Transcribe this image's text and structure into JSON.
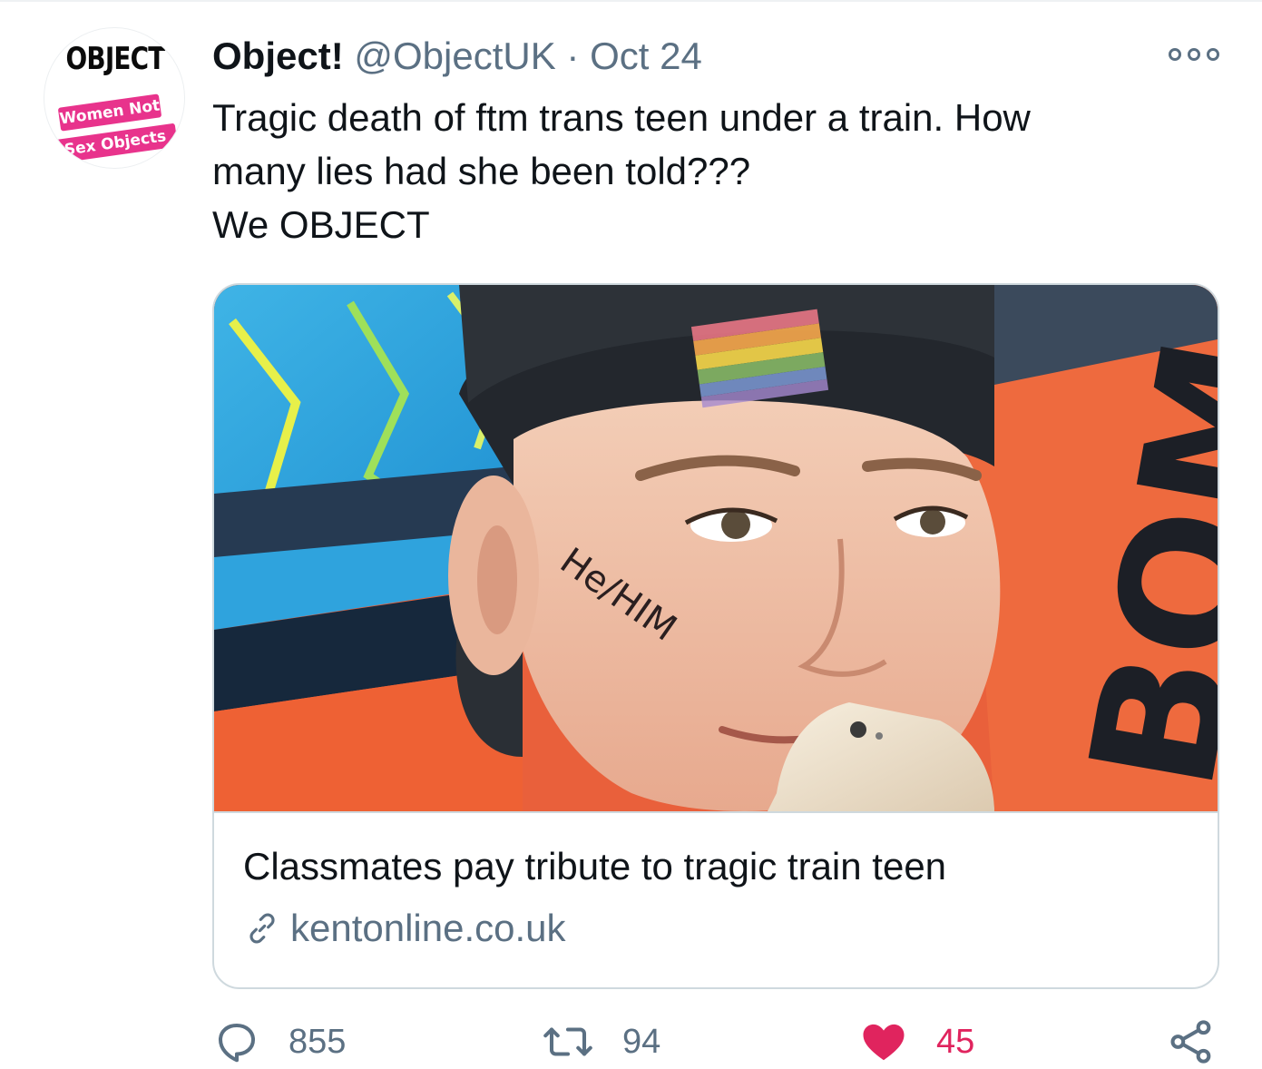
{
  "avatar": {
    "logo_text": "OBJECT",
    "tagline_1": "Women Not",
    "tagline_2": "Sex Objects"
  },
  "tweet": {
    "author_name": "Object!",
    "author_handle": "@ObjectUK",
    "separator": "·",
    "date": "Oct 24",
    "text_lines": [
      "Tragic death of ftm trans teen under a train. How",
      "many lies had she been told???",
      "We OBJECT"
    ]
  },
  "card": {
    "image_caption_face_text": "He/HIM",
    "image_background_text": "BOM",
    "title": "Classmates pay tribute to tragic train teen",
    "domain": "kentonline.co.uk"
  },
  "actions": {
    "reply_count": "855",
    "retweet_count": "94",
    "like_count": "45",
    "like_active": true
  },
  "colors": {
    "text_primary": "#0f1419",
    "text_secondary": "#5b7083",
    "border": "#cfd9de",
    "like": "#e0245e",
    "avatar_accent": "#e8338c"
  },
  "icons": [
    "more-icon",
    "link-icon",
    "reply-icon",
    "retweet-icon",
    "like-icon",
    "share-icon"
  ]
}
